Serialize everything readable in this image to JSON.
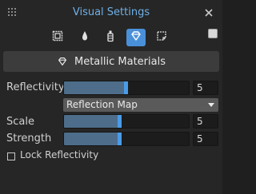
{
  "window": {
    "title": "Visual Settings"
  },
  "toolbar": {
    "tools": [
      {
        "icon": "texture-icon",
        "active": false
      },
      {
        "icon": "drop-icon",
        "active": false
      },
      {
        "icon": "bottle-icon",
        "active": false
      },
      {
        "icon": "material-gem-icon",
        "active": true
      },
      {
        "icon": "stamp-icon",
        "active": false
      }
    ]
  },
  "section": {
    "icon": "material-gem-icon",
    "label": "Metallic Materials"
  },
  "controls": {
    "reflectivity": {
      "label": "Reflectivity",
      "value": "5",
      "fraction": 0.5
    },
    "map_select": {
      "selected": "Reflection Map"
    },
    "scale": {
      "label": "Scale",
      "value": "5",
      "fraction": 0.45
    },
    "strength": {
      "label": "Strength",
      "value": "5",
      "fraction": 0.45
    },
    "lock": {
      "label": "Lock Reflectivity",
      "checked": false
    }
  },
  "colors": {
    "accent": "#4a90d9",
    "title": "#6fb0e6",
    "slider_fill": "#4d6d8a"
  }
}
